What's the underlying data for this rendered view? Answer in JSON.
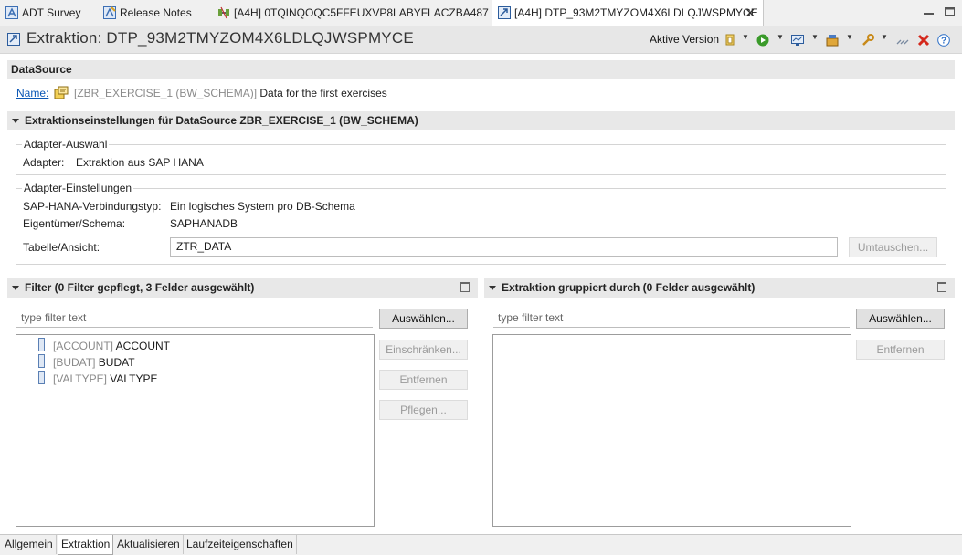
{
  "tabs": [
    {
      "label": "ADT Survey",
      "icon": "survey-icon"
    },
    {
      "label": "Release Notes",
      "icon": "release-notes-icon"
    },
    {
      "label": "[A4H] 0TQINQOQC5FFEUXVP8LABYFLACZBA487",
      "icon": "transformation-icon"
    },
    {
      "label": "[A4H] DTP_93M2TMYZOM4X6LDLQJWSPMYCE",
      "icon": "dtp-icon",
      "active": true
    }
  ],
  "editor": {
    "title": "Extraktion: DTP_93M2TMYZOM4X6LDLQJWSPMYCE",
    "version_label": "Aktive Version"
  },
  "datasource": {
    "section_title": "DataSource",
    "name_link": "Name:",
    "name_tech": "[ZBR_EXERCISE_1 (BW_SCHEMA)]",
    "name_desc": "Data for the first exercises"
  },
  "extraction_settings": {
    "section_title": "Extraktionseinstellungen für DataSource ZBR_EXERCISE_1 (BW_SCHEMA)",
    "adapter_group": {
      "title": "Adapter-Auswahl",
      "adapter_label": "Adapter:",
      "adapter_value": "Extraktion aus SAP HANA"
    },
    "adapter_settings": {
      "title": "Adapter-Einstellungen",
      "conn_label": "SAP-HANA-Verbindungstyp:",
      "conn_value": "Ein logisches System pro DB-Schema",
      "owner_label": "Eigentümer/Schema:",
      "owner_value": "SAPHANADB",
      "table_label": "Tabelle/Ansicht:",
      "table_value": "ZTR_DATA",
      "swap_button": "Umtauschen..."
    }
  },
  "filter_panel": {
    "title": "Filter (0 Filter gepflegt, 3 Felder ausgewählt)",
    "filter_placeholder": "type filter text",
    "select_button": "Auswählen...",
    "restrict_button": "Einschränken...",
    "remove_button": "Entfernen",
    "maintain_button": "Pflegen...",
    "fields": [
      {
        "tech": "[ACCOUNT]",
        "name": "ACCOUNT"
      },
      {
        "tech": "[BUDAT]",
        "name": "BUDAT"
      },
      {
        "tech": "[VALTYPE]",
        "name": "VALTYPE"
      }
    ]
  },
  "grouping_panel": {
    "title": "Extraktion gruppiert durch (0 Felder ausgewählt)",
    "filter_placeholder": "type filter text",
    "select_button": "Auswählen...",
    "remove_button": "Entfernen"
  },
  "bottom_tabs": [
    {
      "label": "Allgemein"
    },
    {
      "label": "Extraktion",
      "active": true
    },
    {
      "label": "Aktualisieren"
    },
    {
      "label": "Laufzeiteigenschaften"
    }
  ],
  "colors": {
    "link": "#0b57b5",
    "section_bg": "#e8e8e8",
    "disabled_text": "#9a9a9a"
  }
}
